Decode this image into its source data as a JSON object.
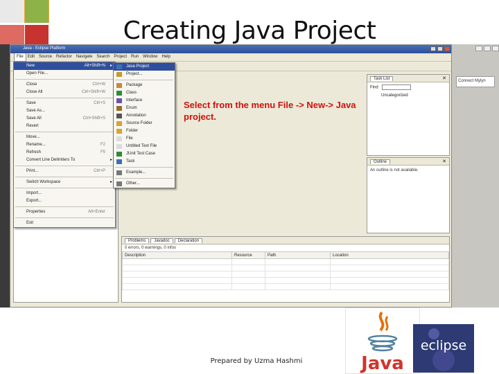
{
  "slide": {
    "title": "Creating Java Project",
    "instruction": "Select from the menu File -> New-> Java project.",
    "footer": "Prepared by Uzma Hashmi",
    "decor_colors": [
      "#f3a53a",
      "#8db247",
      "#de6a61",
      "#c7342f",
      "#e9e9e9"
    ]
  },
  "eclipse": {
    "window_title": "Java - Eclipse Platform",
    "menus": [
      "File",
      "Edit",
      "Source",
      "Refactor",
      "Navigate",
      "Search",
      "Project",
      "Run",
      "Window",
      "Help"
    ],
    "file_menu": {
      "items": [
        {
          "label": "New",
          "shortcut": "Alt+Shift+N",
          "submenu": true,
          "selected": true
        },
        {
          "label": "Open File...",
          "shortcut": "",
          "submenu": false
        },
        {
          "sep": true
        },
        {
          "label": "Close",
          "shortcut": "Ctrl+W",
          "submenu": false
        },
        {
          "label": "Close All",
          "shortcut": "Ctrl+Shift+W",
          "submenu": false
        },
        {
          "sep": true
        },
        {
          "label": "Save",
          "shortcut": "Ctrl+S",
          "submenu": false
        },
        {
          "label": "Save As...",
          "shortcut": "",
          "submenu": false
        },
        {
          "label": "Save All",
          "shortcut": "Ctrl+Shift+S",
          "submenu": false
        },
        {
          "label": "Revert",
          "shortcut": "",
          "submenu": false
        },
        {
          "sep": true
        },
        {
          "label": "Move...",
          "shortcut": "",
          "submenu": false
        },
        {
          "label": "Rename...",
          "shortcut": "F2",
          "submenu": false
        },
        {
          "label": "Refresh",
          "shortcut": "F5",
          "submenu": false
        },
        {
          "label": "Convert Line Delimiters To",
          "shortcut": "",
          "submenu": true
        },
        {
          "sep": true
        },
        {
          "label": "Print...",
          "shortcut": "Ctrl+P",
          "submenu": false
        },
        {
          "sep": true
        },
        {
          "label": "Switch Workspace",
          "shortcut": "",
          "submenu": true
        },
        {
          "sep": true
        },
        {
          "label": "Import...",
          "shortcut": "",
          "submenu": false
        },
        {
          "label": "Export...",
          "shortcut": "",
          "submenu": false
        },
        {
          "sep": true
        },
        {
          "label": "Properties",
          "shortcut": "Alt+Enter",
          "submenu": false
        },
        {
          "sep": true
        },
        {
          "label": "Exit",
          "shortcut": "",
          "submenu": false
        }
      ]
    },
    "new_submenu": {
      "items": [
        {
          "label": "Java Project",
          "selected": true,
          "icon": "java-project-icon"
        },
        {
          "label": "Project...",
          "icon": "project-icon"
        },
        {
          "sep": true
        },
        {
          "label": "Package",
          "icon": "package-icon"
        },
        {
          "label": "Class",
          "icon": "class-icon"
        },
        {
          "label": "Interface",
          "icon": "interface-icon"
        },
        {
          "label": "Enum",
          "icon": "enum-icon"
        },
        {
          "label": "Annotation",
          "icon": "annotation-icon"
        },
        {
          "label": "Source Folder",
          "icon": "source-folder-icon"
        },
        {
          "label": "Folder",
          "icon": "folder-icon"
        },
        {
          "label": "File",
          "icon": "file-icon"
        },
        {
          "label": "Untitled Text File",
          "icon": "text-file-icon"
        },
        {
          "label": "JUnit Test Case",
          "icon": "junit-icon"
        },
        {
          "label": "Task",
          "icon": "task-icon"
        },
        {
          "sep": true
        },
        {
          "label": "Example...",
          "icon": "example-icon"
        },
        {
          "sep": true
        },
        {
          "label": "Other...",
          "icon": "other-icon"
        }
      ]
    },
    "task_list": {
      "tab": "Task List",
      "find_label": "Find",
      "category": "Uncategorized"
    },
    "outline": {
      "tab": "Outline",
      "message": "An outline is not available."
    },
    "bottom_tabs": [
      "Problems",
      "Javadoc",
      "Declaration"
    ],
    "problems_summary": "0 errors, 0 warnings, 0 infos",
    "problems_columns": [
      "Description",
      "Resource",
      "Path",
      "Location"
    ],
    "right_panel_text": "Connect Mylyn"
  },
  "logos": {
    "java_word": "Java",
    "eclipse_word": "eclipse"
  }
}
